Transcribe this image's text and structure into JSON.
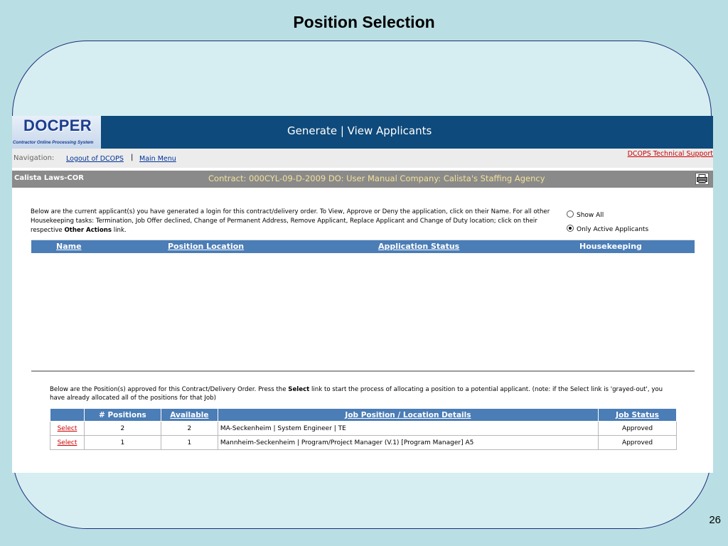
{
  "slide": {
    "title": "Position Selection",
    "page_number": "26"
  },
  "app": {
    "logo_main": "DOCPER",
    "logo_sub": "Contractor Online Processing System",
    "header_title": "Generate | View Applicants",
    "nav": {
      "label": "Navigation:",
      "logout": "Logout of DCOPS",
      "separator": "|",
      "main_menu": "Main Menu",
      "support": "DCOPS Technical Support"
    },
    "info": {
      "user": "Calista Laws-COR",
      "contract": "Contract: 000CYL-09-D-2009   DO: User Manual   Company: Calista's Staffing Agency",
      "print_icon": "printer-icon"
    },
    "intro": {
      "text_a": "Below are the current applicant(s) you have generated a login for this contract/delivery order. To View, Approve or Deny the application, click on their Name.  For all other Housekeeping tasks: Termination, Job Offer declined, Change of Permanent Address, Remove Applicant, Replace Applicant and Change of Duty location; click on their respective ",
      "text_bold": "Other Actions",
      "text_b": " link."
    },
    "filter": {
      "show_all": "Show All",
      "only_active": "Only Active Applicants",
      "selected": "only_active"
    },
    "applicants_table": {
      "headers": [
        "Name",
        "Position Location",
        "Application Status",
        "Housekeeping"
      ],
      "rows": []
    },
    "positions": {
      "intro_a": "Below are the Position(s) approved for this Contract/Delivery Order. Press the ",
      "intro_bold": "Select",
      "intro_b": " link to start the process of allocating a position to a potential applicant. (note: if the Select link is 'grayed-out', you have already allocated all of the positions for that Job)",
      "headers": {
        "blank": "",
        "positions": "# Positions",
        "available": "Available",
        "details": "Job Position / Location Details",
        "status": "Job Status"
      },
      "rows": [
        {
          "action": "Select",
          "positions": "2",
          "available": "2",
          "details": "MA-Seckenheim | System Engineer | TE",
          "status": "Approved"
        },
        {
          "action": "Select",
          "positions": "1",
          "available": "1",
          "details": "Mannheim-Seckenheim | Program/Project Manager (V.1) [Program Manager] A5",
          "status": "Approved"
        }
      ]
    }
  }
}
